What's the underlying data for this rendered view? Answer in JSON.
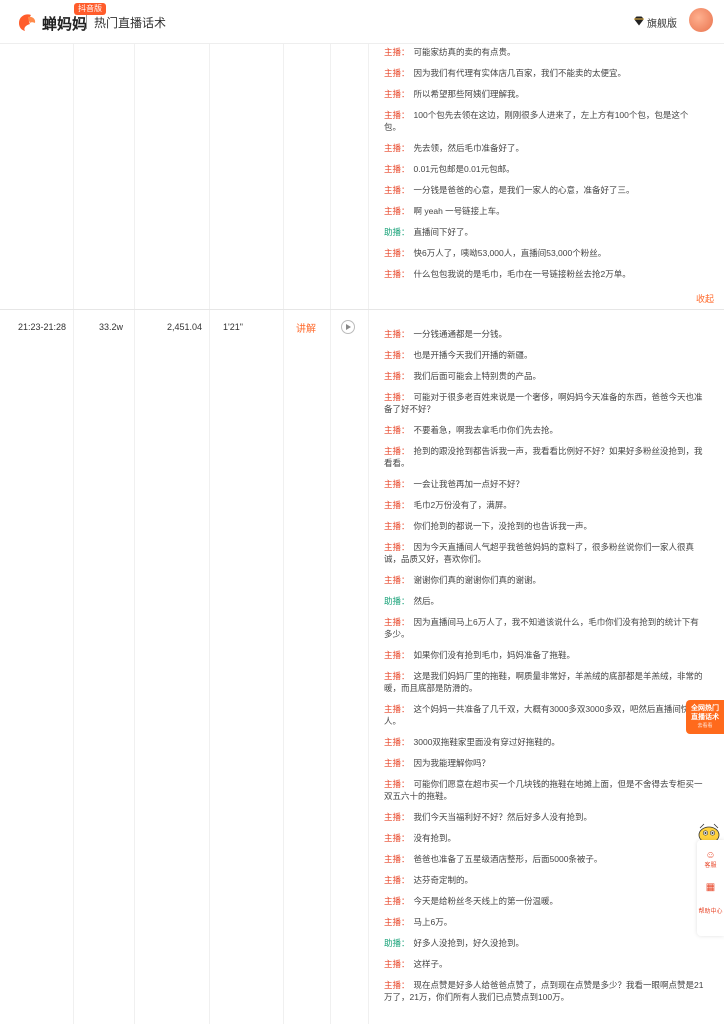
{
  "header": {
    "brand_name": "蝉妈妈",
    "brand_badge": "抖音版",
    "page_title": "热门直播话术",
    "vip_label": "旗舰版",
    "vip_chevron": "›"
  },
  "colors": {
    "accent": "#ff6a2c",
    "host": "#e8472a",
    "assistant": "#1aa37a"
  },
  "speakers": {
    "host": "主播：",
    "assistant": "助播："
  },
  "segments": [
    {
      "lines": [
        {
          "role": "host",
          "text": "可能家纺真的卖的有点贵。"
        },
        {
          "role": "host",
          "text": "因为我们有代理有实体店几百家，我们不能卖的太便宜。"
        },
        {
          "role": "host",
          "text": "所以希望那些阿姨们理解我。"
        },
        {
          "role": "host",
          "text": "100个包先去领在这边，刚刚很多人进来了，左上方有100个包，包是这个包。"
        },
        {
          "role": "host",
          "text": "先去领，然后毛巾准备好了。"
        },
        {
          "role": "host",
          "text": "0.01元包邮是0.01元包邮。"
        },
        {
          "role": "host",
          "text": "一分钱是爸爸的心意，是我们一家人的心意，准备好了三。"
        },
        {
          "role": "host",
          "text": "啊 yeah 一号链接上车。"
        },
        {
          "role": "assistant",
          "text": "直播间下好了。"
        },
        {
          "role": "host",
          "text": "快6万人了，咦呦53,000人，直播间53,000个粉丝。"
        },
        {
          "role": "host",
          "text": "什么包包我说的是毛巾，毛巾在一号链接粉丝去抢2万单。"
        }
      ],
      "collapse_label": "收起"
    },
    {
      "time_range": "21:23-21:28",
      "viewers": "33.2w",
      "gmv": "2,451.04",
      "duration": "1'21\"",
      "action_label": "讲解",
      "lines": [
        {
          "role": "host",
          "text": "一分钱通通都是一分钱。"
        },
        {
          "role": "host",
          "text": "也是开播今天我们开播的新疆。"
        },
        {
          "role": "host",
          "text": "我们后面可能会上特别贵的产品。"
        },
        {
          "role": "host",
          "text": "可能对于很多老百姓来说是一个奢侈，啊妈妈今天准备的东西，爸爸今天也准备了好不好？"
        },
        {
          "role": "host",
          "text": "不要着急，啊我去拿毛巾你们先去抢。"
        },
        {
          "role": "host",
          "text": "抢到的跟没抢到都告诉我一声，我看看比例好不好？如果好多粉丝没抢到，我看看。"
        },
        {
          "role": "host",
          "text": "一会让我爸再加一点好不好？"
        },
        {
          "role": "host",
          "text": "毛巾2万份没有了，满屏。"
        },
        {
          "role": "host",
          "text": "你们抢到的都说一下，没抢到的也告诉我一声。"
        },
        {
          "role": "host",
          "text": "因为今天直播间人气超乎我爸爸妈妈的意料了，很多粉丝说你们一家人很真诚，品质又好，喜欢你们。"
        },
        {
          "role": "host",
          "text": "谢谢你们真的谢谢你们真的谢谢。"
        },
        {
          "role": "assistant",
          "text": "然后。"
        },
        {
          "role": "host",
          "text": "因为直播间马上6万人了，我不知道该说什么，毛巾你们没有抢到的统计下有多少。"
        },
        {
          "role": "host",
          "text": "如果你们没有抢到毛巾，妈妈准备了拖鞋。"
        },
        {
          "role": "host",
          "text": "这是我们妈妈厂里的拖鞋，啊质量非常好，羊羔绒的底部都是羊羔绒，非常的暖，而且底部是防滑的。"
        },
        {
          "role": "host",
          "text": "这个妈妈一共准备了几千双，大概有3000多双3000多双，吧然后直播间快人。"
        },
        {
          "role": "host",
          "text": "3000双拖鞋家里面没有穿过好拖鞋的。"
        },
        {
          "role": "host",
          "text": "因为我能理解你吗？"
        },
        {
          "role": "host",
          "text": "可能你们愿意在超市买一个几块钱的拖鞋在地摊上面，但是不舍得去专柜买一双五六十的拖鞋。"
        },
        {
          "role": "host",
          "text": "我们今天当福利好不好？然后好多人没有抢到。"
        },
        {
          "role": "host",
          "text": "没有抢到。"
        },
        {
          "role": "host",
          "text": "爸爸也准备了五星级酒店整形，后面5000条被子。"
        },
        {
          "role": "host",
          "text": "达芬奇定制的。"
        },
        {
          "role": "host",
          "text": "今天是给粉丝冬天线上的第一份温暖。"
        },
        {
          "role": "host",
          "text": "马上6万。"
        },
        {
          "role": "assistant",
          "text": "好多人没抢到，好久没抢到。"
        },
        {
          "role": "host",
          "text": "这样子。"
        },
        {
          "role": "host",
          "text": "现在点赞是好多人给爸爸点赞了，点到现在点赞是多少？我看一眼啊点赞是21万了，21万，你们所有人我们已点赞点到100万。"
        }
      ]
    }
  ],
  "promo": {
    "line1": "全网热门",
    "line2": "直播话术",
    "line3": "去看看"
  },
  "side_panel": {
    "item1": "客服",
    "item2": "帮助中心"
  }
}
